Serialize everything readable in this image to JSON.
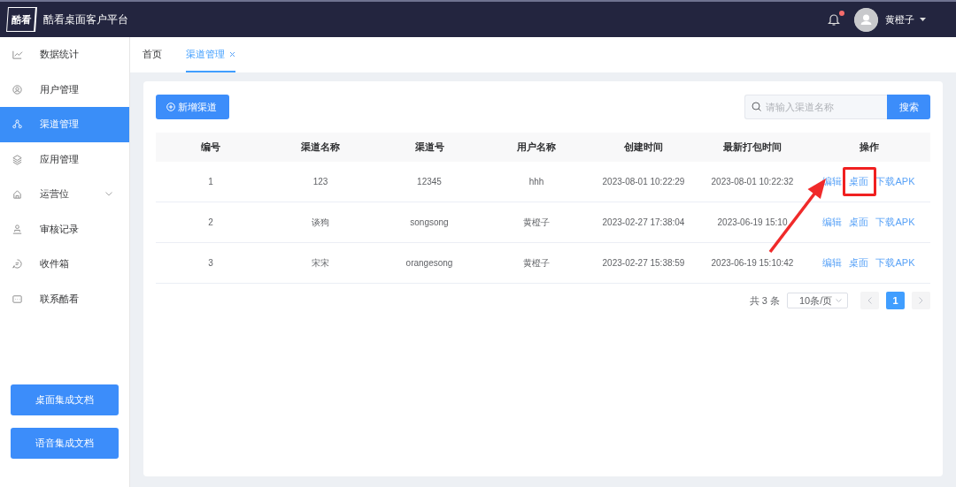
{
  "header": {
    "app_title": "酷看桌面客户平台",
    "logo_text": "酷看",
    "notification": true,
    "user_name": "黄橙子"
  },
  "sidebar": {
    "items": [
      {
        "label": "数据统计",
        "selected": false
      },
      {
        "label": "用户管理",
        "selected": false
      },
      {
        "label": "渠道管理",
        "selected": true
      },
      {
        "label": "应用管理",
        "selected": false
      },
      {
        "label": "运营位",
        "selected": false,
        "expanded": false
      },
      {
        "label": "审核记录",
        "selected": false
      },
      {
        "label": "收件箱",
        "selected": false
      },
      {
        "label": "联系酷看",
        "selected": false
      }
    ],
    "buttons": [
      "桌面集成文档",
      "语音集成文档"
    ]
  },
  "tabs": [
    {
      "label": "首页",
      "selected": false,
      "closable": false
    },
    {
      "label": "渠道管理",
      "selected": true,
      "closable": true
    }
  ],
  "toolbar": {
    "add_button": "新增渠道",
    "search": {
      "placeholder": "请输入渠道名称"
    },
    "search_button": "搜索"
  },
  "table": {
    "columns": [
      "编号",
      "渠道名称",
      "渠道号",
      "用户名称",
      "创建时间",
      "最新打包时间",
      "操作"
    ],
    "rows": [
      {
        "cells": [
          "1",
          "123",
          "12345",
          "hhh",
          "2023-08-01 10:22:29",
          "2023-08-01 10:22:32"
        ],
        "actions": [
          {
            "label": "编辑",
            "highlighted": false
          },
          {
            "label": "桌面",
            "highlighted": true
          },
          {
            "label": "下载APK",
            "highlighted": false
          }
        ]
      },
      {
        "cells": [
          "2",
          "谈狗",
          "songsong",
          "黄橙子",
          "2023-02-27 17:38:04",
          "2023-06-19 15:10"
        ],
        "actions": [
          {
            "label": "编辑",
            "highlighted": false
          },
          {
            "label": "桌面",
            "highlighted": false
          },
          {
            "label": "下载APK",
            "highlighted": false
          }
        ]
      },
      {
        "cells": [
          "3",
          "宋宋",
          "orangesong",
          "黄橙子",
          "2023-02-27 15:38:59",
          "2023-06-19 15:10:42"
        ],
        "actions": [
          {
            "label": "编辑",
            "highlighted": false
          },
          {
            "label": "桌面",
            "highlighted": false
          },
          {
            "label": "下载APK",
            "highlighted": false
          }
        ]
      }
    ]
  },
  "pagination": {
    "total": "共 3 条",
    "page_size": "10条/页",
    "prev_disabled": true,
    "next_disabled": true,
    "pages": [
      {
        "label": "1",
        "selected": true
      }
    ]
  }
}
